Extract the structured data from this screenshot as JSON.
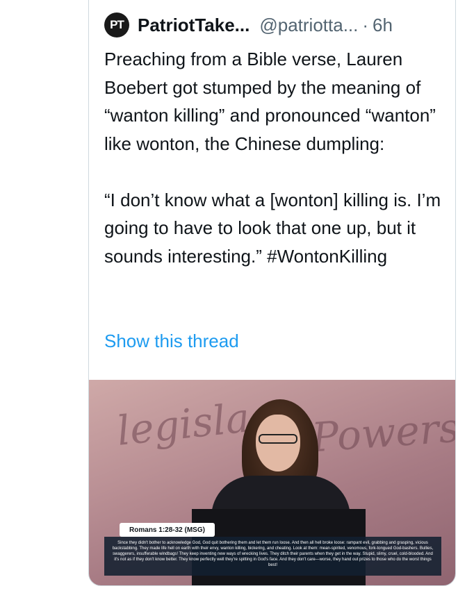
{
  "tweet": {
    "avatar_initials": "PT",
    "display_name": "PatriotTake...",
    "handle": "@patriotta...",
    "separator": "·",
    "time": "6h",
    "paragraph1": "Preaching from a Bible verse, Lauren Boebert got stumped by the meaning of “wanton killing” and pronounced “wanton” like wonton, the Chinese dumpling:",
    "paragraph2": "“I don’t know what a [wonton] killing is. I’m going to have to look that one up, but it sounds interesting.” #WontonKilling",
    "show_thread": "Show this thread"
  },
  "media": {
    "script_word1": "legisla",
    "script_word2": "Powers h",
    "verse_reference": "Romans 1:28-32 (MSG)",
    "verse_text": "Since they didn't bother to acknowledge God, God quit bothering them and let them run loose. And then all hell broke loose: rampant evil, grabbing and grasping, vicious backstabbing. They made life hell on earth with their envy, wanton killing, bickering, and cheating. Look at them: mean-spirited, venomous, fork-tongued God-bashers. Bullies, swaggerers, insufferable windbags! They keep inventing new ways of wrecking lives. They ditch their parents when they get in the way. Stupid, slimy, cruel, cold-blooded. And it's not as if they don't know better. They know perfectly well they're spitting in God's face. And they don't care—worse, they hand out prizes to those who do the worst things best!"
  }
}
